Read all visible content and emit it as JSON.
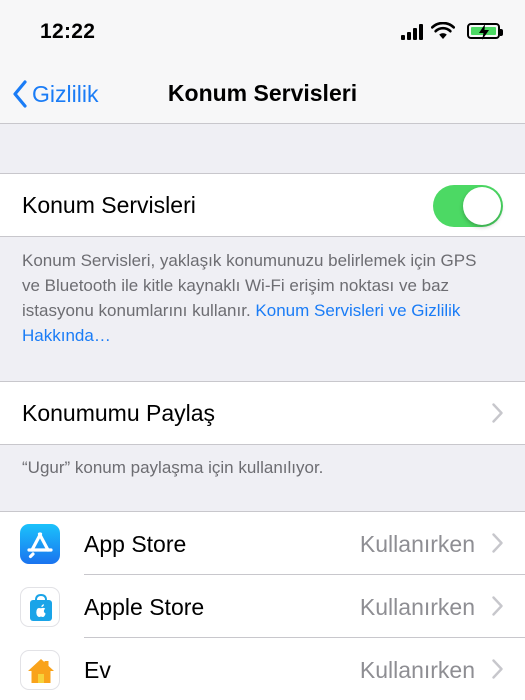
{
  "status_bar": {
    "time": "12:22"
  },
  "nav": {
    "back_label": "Gizlilik",
    "title": "Konum Servisleri"
  },
  "location_services": {
    "label": "Konum Servisleri",
    "enabled": true,
    "description": "Konum Servisleri, yaklaşık konumunuzu belirlemek için GPS ve Bluetooth ile kitle kaynaklı Wi-Fi erişim noktası ve baz istasyonu konumlarını kullanır.",
    "link_text": "Konum Servisleri ve Gizlilik Hakkında…"
  },
  "share_location": {
    "label": "Konumumu Paylaş",
    "footer": "“Ugur” konum paylaşma için kullanılıyor."
  },
  "apps": [
    {
      "name": "App Store",
      "status": "Kullanırken",
      "icon": "app-store-icon"
    },
    {
      "name": "Apple Store",
      "status": "Kullanırken",
      "icon": "apple-store-icon"
    },
    {
      "name": "Ev",
      "status": "Kullanırken",
      "icon": "home-icon"
    }
  ],
  "colors": {
    "accent": "#1a7cf6",
    "toggle_on": "#4cd964",
    "background": "#efeff4",
    "secondary_text": "#8e8e93"
  }
}
